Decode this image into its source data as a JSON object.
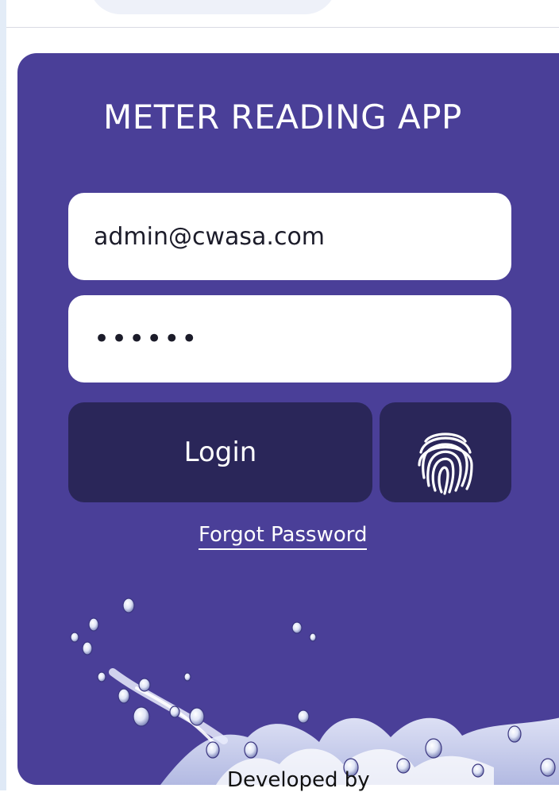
{
  "app": {
    "title": "METER READING APP"
  },
  "form": {
    "email_value": "admin@cwasa.com",
    "password_value": "••••••",
    "login_label": "Login",
    "forgot_label": "Forgot Password"
  },
  "footer": {
    "text": "Developed by"
  },
  "icons": {
    "fingerprint": "fingerprint-icon",
    "splash": "water-splash-image"
  },
  "colors": {
    "card_bg": "#4a3f98",
    "button_bg": "#2a2659",
    "field_bg": "#ffffff",
    "text_light": "#ffffff"
  }
}
